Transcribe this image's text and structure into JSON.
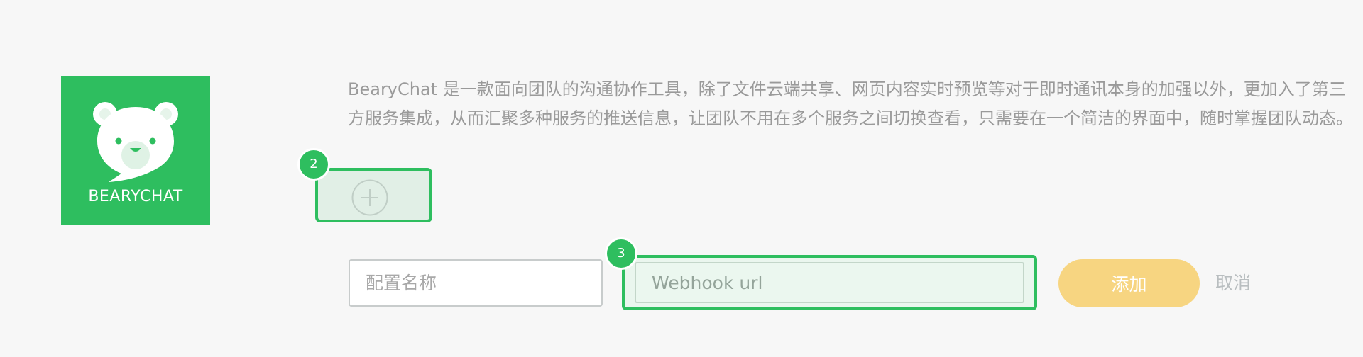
{
  "logo": {
    "text": "BEARYCHAT",
    "icon": "bear-icon",
    "color": "#2ebe5f"
  },
  "description": "BearyChat 是一款面向团队的沟通协作工具，除了文件云端共享、网页内容实时预览等对于即时通讯本身的加强以外，更加入了第三方服务集成，从而汇聚多种服务的推送信息，让团队不用在多个服务之间切换查看，只需要在一个简洁的界面中，随时掌握团队动态。",
  "add_tile": {
    "icon": "plus-circle-icon",
    "badge": "2"
  },
  "form": {
    "name_field": {
      "placeholder": "配置名称",
      "value": ""
    },
    "webhook_field": {
      "placeholder": "Webhook url",
      "value": "",
      "badge": "3"
    },
    "submit_label": "添加",
    "cancel_label": "取消"
  },
  "colors": {
    "accent": "#2ebe5f",
    "submit": "#f7d581",
    "background": "#f7f7f7"
  }
}
